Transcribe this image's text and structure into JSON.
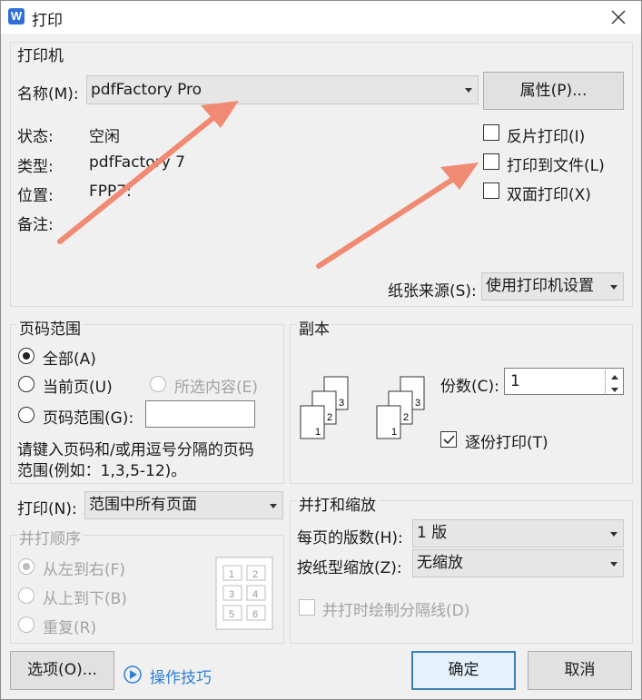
{
  "window": {
    "title": "打印",
    "app_icon_letter": "W"
  },
  "printer": {
    "group_label": "打印机",
    "name_label": "名称(M):",
    "name_value": "pdfFactory Pro",
    "properties_button": "属性(P)...",
    "status_label": "状态:",
    "status_value": "空闲",
    "type_label": "类型:",
    "type_value": "pdfFactory 7",
    "location_label": "位置:",
    "location_value": "FPP7:",
    "comment_label": "备注:",
    "reverse_print": "反片打印(I)",
    "print_to_file": "打印到文件(L)",
    "duplex": "双面打印(X)",
    "paper_source_label": "纸张来源(S):",
    "paper_source_value": "使用打印机设置"
  },
  "page_range": {
    "group_label": "页码范围",
    "all": "全部(A)",
    "current": "当前页(U)",
    "selection": "所选内容(E)",
    "pages": "页码范围(G):",
    "pages_value": "",
    "hint_line1": "请键入页码和/或用逗号分隔的页码",
    "hint_line2": "范围(例如：1,3,5-12)。"
  },
  "copies": {
    "group_label": "副本",
    "count_label": "份数(C):",
    "count_value": "1",
    "collate": "逐份打印(T)",
    "stack_a": [
      "1",
      "2",
      "3"
    ],
    "stack_b": [
      "1",
      "2",
      "3"
    ]
  },
  "print_what": {
    "label": "打印(N):",
    "value": "范围中所有页面"
  },
  "print_order": {
    "group_label": "并打顺序",
    "left_to_right": "从左到右(F)",
    "top_to_bottom": "从上到下(B)",
    "repeat": "重复(R)",
    "grid": [
      "1",
      "2",
      "3",
      "4",
      "5",
      "6"
    ]
  },
  "zoom": {
    "group_label": "并打和缩放",
    "pages_per_sheet_label": "每页的版数(H):",
    "pages_per_sheet_value": "1 版",
    "scale_label": "按纸型缩放(Z):",
    "scale_value": "无缩放",
    "draw_borders": "并打时绘制分隔线(D)"
  },
  "footer": {
    "options_button": "选项(O)...",
    "tips_link": "操作技巧",
    "ok_button": "确定",
    "cancel_button": "取消"
  },
  "colors": {
    "arrow": "#f08a72",
    "link": "#2f7fd8",
    "accent": "#3c7fb1"
  }
}
